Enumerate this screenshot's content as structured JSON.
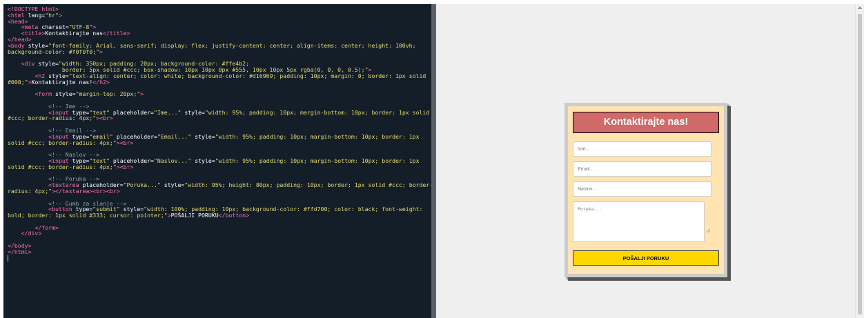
{
  "editor": {
    "lines": [
      [
        {
          "c": "tag",
          "t": "<!DOCTYPE html>"
        }
      ],
      [
        {
          "c": "tag",
          "t": "<html "
        },
        {
          "c": "txt",
          "t": "lang="
        },
        {
          "c": "str",
          "t": "\"hr\""
        },
        {
          "c": "tag",
          "t": ">"
        }
      ],
      [
        {
          "c": "tag",
          "t": "<head>"
        }
      ],
      [
        {
          "c": "txt",
          "t": "    "
        },
        {
          "c": "tag",
          "t": "<meta "
        },
        {
          "c": "txt",
          "t": "charset="
        },
        {
          "c": "str",
          "t": "\"UTF-8\""
        },
        {
          "c": "tag",
          "t": ">"
        }
      ],
      [
        {
          "c": "txt",
          "t": "    "
        },
        {
          "c": "tag",
          "t": "<title>"
        },
        {
          "c": "txt",
          "t": "Kontaktirajte nas"
        },
        {
          "c": "tag",
          "t": "</title>"
        }
      ],
      [
        {
          "c": "tag",
          "t": "</head>"
        }
      ],
      [
        {
          "c": "tag",
          "t": "<body "
        },
        {
          "c": "txt",
          "t": "style="
        },
        {
          "c": "str",
          "t": "\"font-family: Arial, sans-serif; display: flex; justify-content: center; align-items: center; height: 100vh;"
        }
      ],
      [
        {
          "c": "str",
          "t": "background-color: #f0f0f0;\""
        },
        {
          "c": "tag",
          "t": ">"
        }
      ],
      [
        {
          "c": "txt",
          "t": ""
        }
      ],
      [
        {
          "c": "txt",
          "t": "    "
        },
        {
          "c": "tag",
          "t": "<div "
        },
        {
          "c": "txt",
          "t": "style="
        },
        {
          "c": "str",
          "t": "\"width: 350px; padding: 20px; background-color: #ffe4b2;"
        }
      ],
      [
        {
          "c": "str",
          "t": "                border: 5px solid #ccc; box-shadow: 10px 10px 0px #555, 10px 10px 5px rgba(0, 0, 0, 0.5);\""
        },
        {
          "c": "tag",
          "t": ">"
        }
      ],
      [
        {
          "c": "txt",
          "t": "        "
        },
        {
          "c": "tag",
          "t": "<h2 "
        },
        {
          "c": "txt",
          "t": "style="
        },
        {
          "c": "str",
          "t": "\"text-align: center; color: white; background-color: #d16969; padding: 10px; margin: 0; border: 1px solid"
        }
      ],
      [
        {
          "c": "str",
          "t": "#000;\""
        },
        {
          "c": "tag",
          "t": ">"
        },
        {
          "c": "txt",
          "t": "Kontaktirajte nas!"
        },
        {
          "c": "tag",
          "t": "</h2>"
        }
      ],
      [
        {
          "c": "txt",
          "t": ""
        }
      ],
      [
        {
          "c": "txt",
          "t": "        "
        },
        {
          "c": "tag",
          "t": "<form "
        },
        {
          "c": "txt",
          "t": "style="
        },
        {
          "c": "str",
          "t": "\"margin-top: 20px;\""
        },
        {
          "c": "tag",
          "t": ">"
        }
      ],
      [
        {
          "c": "txt",
          "t": ""
        }
      ],
      [
        {
          "c": "txt",
          "t": "            "
        },
        {
          "c": "cmt",
          "t": "<!-- Ime -->"
        }
      ],
      [
        {
          "c": "txt",
          "t": "            "
        },
        {
          "c": "tag",
          "t": "<input "
        },
        {
          "c": "txt",
          "t": "type="
        },
        {
          "c": "str",
          "t": "\"text\""
        },
        {
          "c": "txt",
          "t": " placeholder="
        },
        {
          "c": "str",
          "t": "\"Ime...\""
        },
        {
          "c": "txt",
          "t": " style="
        },
        {
          "c": "str",
          "t": "\"width: 95%; padding: 10px; margin-bottom: 10px; border: 1px solid"
        }
      ],
      [
        {
          "c": "str",
          "t": "#ccc; border-radius: 4px;\""
        },
        {
          "c": "tag",
          "t": "><br>"
        }
      ],
      [
        {
          "c": "txt",
          "t": ""
        }
      ],
      [
        {
          "c": "txt",
          "t": "            "
        },
        {
          "c": "cmt",
          "t": "<!-- Email -->"
        }
      ],
      [
        {
          "c": "txt",
          "t": "            "
        },
        {
          "c": "tag",
          "t": "<input "
        },
        {
          "c": "txt",
          "t": "type="
        },
        {
          "c": "str",
          "t": "\"email\""
        },
        {
          "c": "txt",
          "t": " placeholder="
        },
        {
          "c": "str",
          "t": "\"Email...\""
        },
        {
          "c": "txt",
          "t": " style="
        },
        {
          "c": "str",
          "t": "\"width: 95%; padding: 10px; margin-bottom: 10px; border: 1px"
        }
      ],
      [
        {
          "c": "str",
          "t": "solid #ccc; border-radius: 4px;\""
        },
        {
          "c": "tag",
          "t": "><br>"
        }
      ],
      [
        {
          "c": "txt",
          "t": ""
        }
      ],
      [
        {
          "c": "txt",
          "t": "            "
        },
        {
          "c": "cmt",
          "t": "<!-- Naslov -->"
        }
      ],
      [
        {
          "c": "txt",
          "t": "            "
        },
        {
          "c": "tag",
          "t": "<input "
        },
        {
          "c": "txt",
          "t": "type="
        },
        {
          "c": "str",
          "t": "\"text\""
        },
        {
          "c": "txt",
          "t": " placeholder="
        },
        {
          "c": "str",
          "t": "\"Naslov...\""
        },
        {
          "c": "txt",
          "t": " style="
        },
        {
          "c": "str",
          "t": "\"width: 95%; padding: 10px; margin-bottom: 10px; border: 1px"
        }
      ],
      [
        {
          "c": "str",
          "t": "solid #ccc; border-radius: 4px;\""
        },
        {
          "c": "tag",
          "t": "><br>"
        }
      ],
      [
        {
          "c": "txt",
          "t": ""
        }
      ],
      [
        {
          "c": "txt",
          "t": "            "
        },
        {
          "c": "cmt",
          "t": "<!-- Poruka -->"
        }
      ],
      [
        {
          "c": "txt",
          "t": "            "
        },
        {
          "c": "tag",
          "t": "<textarea "
        },
        {
          "c": "txt",
          "t": "placeholder="
        },
        {
          "c": "str",
          "t": "\"Poruka...\""
        },
        {
          "c": "txt",
          "t": " style="
        },
        {
          "c": "str",
          "t": "\"width: 95%; height: 80px; padding: 10px; border: 1px solid #ccc; border-"
        }
      ],
      [
        {
          "c": "str",
          "t": "radius: 4px;\""
        },
        {
          "c": "tag",
          "t": "></textarea><br><br>"
        }
      ],
      [
        {
          "c": "txt",
          "t": ""
        }
      ],
      [
        {
          "c": "txt",
          "t": "            "
        },
        {
          "c": "cmt",
          "t": "<!-- Gumb za slanje -->"
        }
      ],
      [
        {
          "c": "txt",
          "t": "            "
        },
        {
          "c": "tag",
          "t": "<button "
        },
        {
          "c": "txt",
          "t": "type="
        },
        {
          "c": "str",
          "t": "\"submit\""
        },
        {
          "c": "txt",
          "t": " style="
        },
        {
          "c": "str",
          "t": "\"width: 100%; padding: 10px; background-color: #ffd700; color: black; font-weight:"
        }
      ],
      [
        {
          "c": "str",
          "t": "bold; border: 1px solid #333; cursor: pointer;\""
        },
        {
          "c": "tag",
          "t": ">"
        },
        {
          "c": "txt",
          "t": "POŠALJI PORUKU"
        },
        {
          "c": "tag",
          "t": "</button>"
        }
      ],
      [
        {
          "c": "txt",
          "t": ""
        }
      ],
      [
        {
          "c": "txt",
          "t": "        "
        },
        {
          "c": "tag",
          "t": "</form>"
        }
      ],
      [
        {
          "c": "txt",
          "t": "    "
        },
        {
          "c": "tag",
          "t": "</div>"
        }
      ],
      [
        {
          "c": "txt",
          "t": ""
        }
      ],
      [
        {
          "c": "tag",
          "t": "</body>"
        }
      ],
      [
        {
          "c": "tag",
          "t": "</html>"
        }
      ]
    ]
  },
  "preview": {
    "title": "Kontaktirajte nas!",
    "name_placeholder": "Ime...",
    "email_placeholder": "Email...",
    "subject_placeholder": "Naslov...",
    "message_placeholder": "Poruka...",
    "submit_label": "POŠALJI PORUKU"
  },
  "colors": {
    "editor_bg": "#141e28",
    "tag": "#ff6fb0",
    "comment": "#8fa0b0",
    "string": "#e6db74",
    "preview_bg": "#efefef",
    "card_bg": "#ffe4b2",
    "title_bg": "#d16969",
    "button_bg": "#ffd700"
  },
  "icons": {
    "scroll_up": "scroll-up-arrow-icon",
    "resize": "resize-grip-icon"
  }
}
